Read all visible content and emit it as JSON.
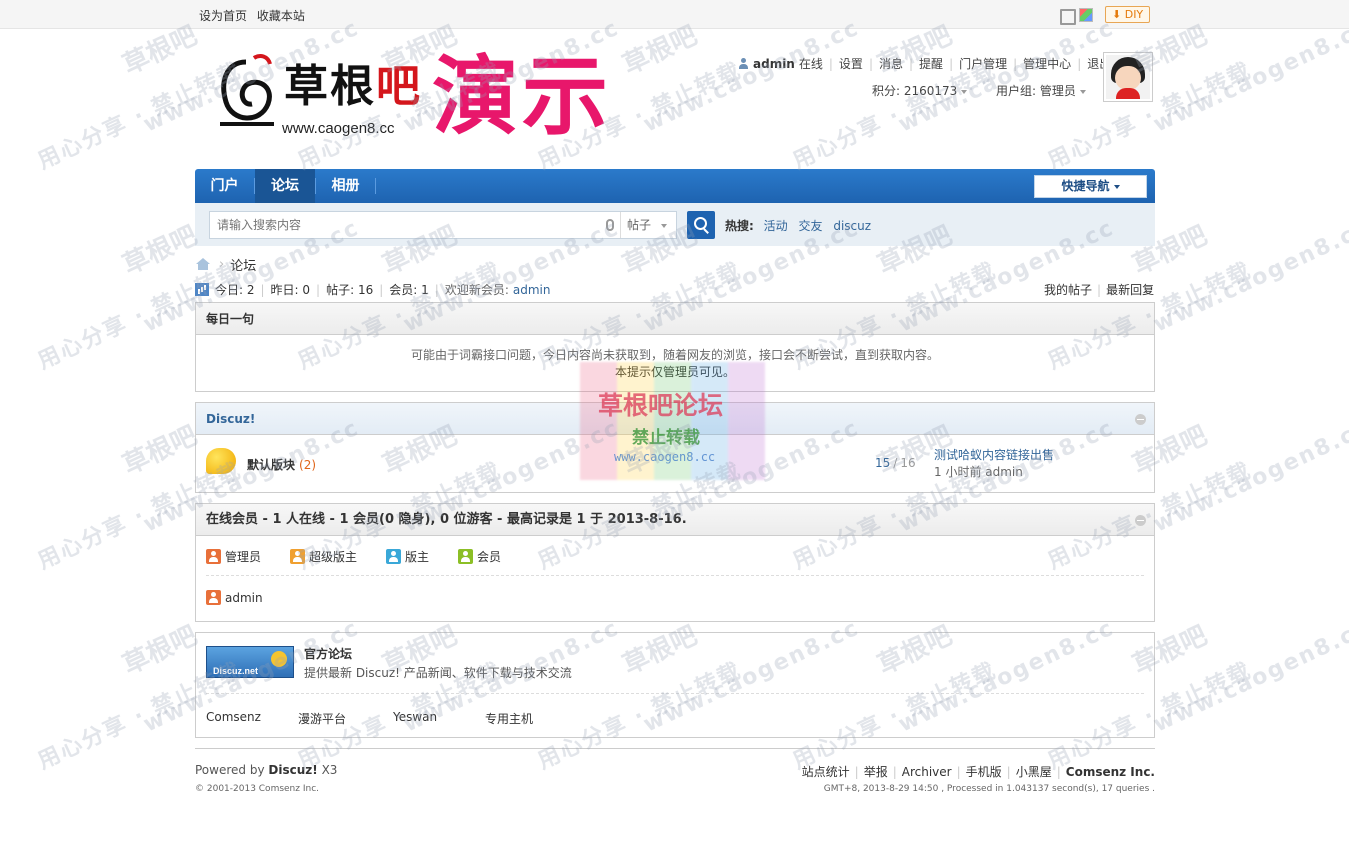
{
  "topbar": {
    "set_home": "设为首页",
    "bookmark": "收藏本站",
    "diy": "DIY"
  },
  "logo": {
    "name_main": "草根",
    "name_accent": "吧",
    "url": "www.caogen8.cc",
    "demo": "演示"
  },
  "user": {
    "name": "admin",
    "status": "在线",
    "links": [
      "设置",
      "消息",
      "提醒",
      "门户管理",
      "管理中心",
      "退出"
    ],
    "points": "积分: 2160173",
    "group": "用户组: 管理员"
  },
  "nav": {
    "items": [
      "门户",
      "论坛",
      "相册"
    ],
    "active": "论坛",
    "quick_nav": "快捷导航"
  },
  "search": {
    "placeholder": "请输入搜索内容",
    "type": "帖子",
    "hot_label": "热搜:",
    "hot_terms": [
      "活动",
      "交友",
      "discuz"
    ]
  },
  "breadcrumb": {
    "current": "论坛"
  },
  "stats": {
    "today": "今日: 2",
    "yesterday": "昨日: 0",
    "posts": "帖子: 16",
    "members": "会员: 1",
    "welcome": "欢迎新会员:",
    "new_member": "admin",
    "my_posts": "我的帖子",
    "latest": "最新回复"
  },
  "daily": {
    "title": "每日一句",
    "line1": "可能由于词霸接口问题，今日内容尚未获取到，随着网友的浏览，接口会不断尝试，直到获取内容。",
    "line2": "本提示仅管理员可见。"
  },
  "category": {
    "title": "Discuz!",
    "forum_name": "默认版块",
    "forum_today": "(2)",
    "threads": "15",
    "posts": "16",
    "last_title": "测试哈蚁内容链接出售",
    "last_time": "1 小时前 admin"
  },
  "online": {
    "title": "在线会员 - 1 人在线 - 1 会员(0 隐身), 0 位游客 - 最高记录是 1 于 2013-8-16.",
    "roles": [
      {
        "label": "管理员",
        "color": "#e8703a"
      },
      {
        "label": "超级版主",
        "color": "#f0a030"
      },
      {
        "label": "版主",
        "color": "#3aa8d8"
      },
      {
        "label": "会员",
        "color": "#8cbf26"
      }
    ],
    "members": [
      "admin"
    ]
  },
  "links": {
    "logo_text": "Discuz.net",
    "title": "官方论坛",
    "desc": "提供最新 Discuz! 产品新闻、软件下载与技术交流",
    "partners": [
      "Comsenz",
      "漫游平台",
      "Yeswan",
      "专用主机"
    ]
  },
  "footer": {
    "powered_prefix": "Powered by",
    "powered_brand": "Discuz!",
    "powered_ver": "X3",
    "copyright": "© 2001-2013 Comsenz Inc.",
    "links": [
      "站点统计",
      "举报",
      "Archiver",
      "手机版",
      "小黑屋"
    ],
    "company": "Comsenz Inc.",
    "info": "GMT+8, 2013-8-29 14:50 , Processed in 1.043137 second(s), 17 queries ."
  },
  "watermark": {
    "line_a": "草根吧",
    "line_b": "www.caogen8.cc",
    "line_c": "用心分享 · 禁止转载",
    "center_title": "草根吧论坛",
    "center_sub": "禁止转载",
    "center_url": "www.caogen8.cc"
  }
}
